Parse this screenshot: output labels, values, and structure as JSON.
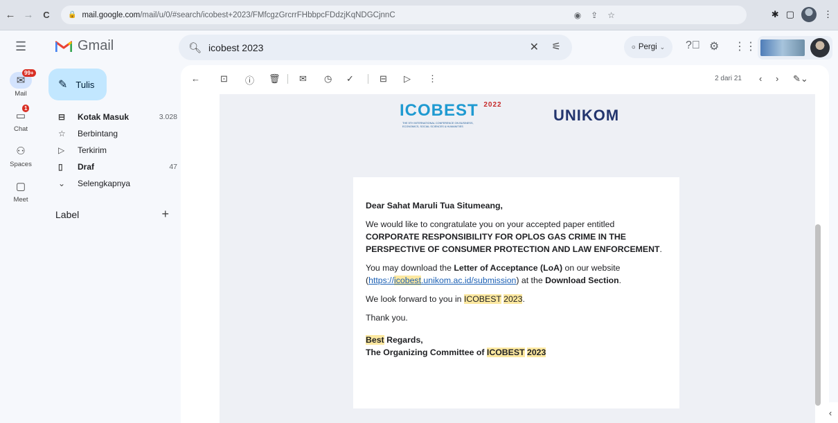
{
  "browser": {
    "back": "←",
    "forward": "→",
    "reload": "C",
    "url_host": "mail.google.com",
    "url_path": "/mail/u/0/#search/icobest+2023/FMfcgzGrcrrFHbbpcFDdzjKqNDGCjnnC"
  },
  "gmail": {
    "brand": "Gmail",
    "search_query": "icobest 2023",
    "status_label": "Pergi"
  },
  "rail": [
    {
      "label": "Mail",
      "badge": "99+"
    },
    {
      "label": "Chat",
      "badge": "1"
    },
    {
      "label": "Spaces",
      "badge": ""
    },
    {
      "label": "Meet",
      "badge": ""
    }
  ],
  "sidebar": {
    "compose_label": "Tulis",
    "folders": [
      {
        "label": "Kotak Masuk",
        "count": "3.028"
      },
      {
        "label": "Berbintang",
        "count": ""
      },
      {
        "label": "Terkirim",
        "count": ""
      },
      {
        "label": "Draf",
        "count": "47"
      },
      {
        "label": "Selengkapnya",
        "count": ""
      }
    ],
    "labels_heading": "Label"
  },
  "toolbar": {
    "pager": "2 dari 21"
  },
  "email": {
    "logo_left": "ICOBEST",
    "logo_left_year": "2022",
    "logo_left_sub": "THE 5TH INTERNATIONAL CONFERENCE ON BUSINESS, ECONOMICS, SOCIAL SCIENCES & HUMANITIES",
    "logo_right": "UNIKOM",
    "greeting": "Dear Sahat Maruli Tua Situmeang,",
    "p1_a": "We would like to congratulate you on your accepted paper entitled ",
    "p1_title": "CORPORATE RESPONSIBILITY FOR OPLOS GAS CRIME IN THE PERSPECTIVE OF CONSUMER PROTECTION AND LAW ENFORCEMENT",
    "p1_end": ".",
    "p2_a": "You may download the ",
    "p2_loa": "Letter of Acceptance (LoA)",
    "p2_b": " on our website (",
    "p2_link_pre": "https://",
    "p2_link_hl": "icobest",
    "p2_link_post": ".unikom.ac.id/submission",
    "p2_c": ") at the ",
    "p2_section": "Download Section",
    "p2_end": ".",
    "p3_a": "We look forward to you in ",
    "p3_hl1": "ICOBEST",
    "p3_sp": " ",
    "p3_hl2": "2023",
    "p3_end": ".",
    "p4": "Thank you.",
    "sign1_hl": "Best",
    "sign1_rest": " Regards,",
    "sign2_a": "The Organizing Committee of ",
    "sign2_hl1": "ICOBEST",
    "sign2_sp": " ",
    "sign2_hl2": "2023"
  }
}
